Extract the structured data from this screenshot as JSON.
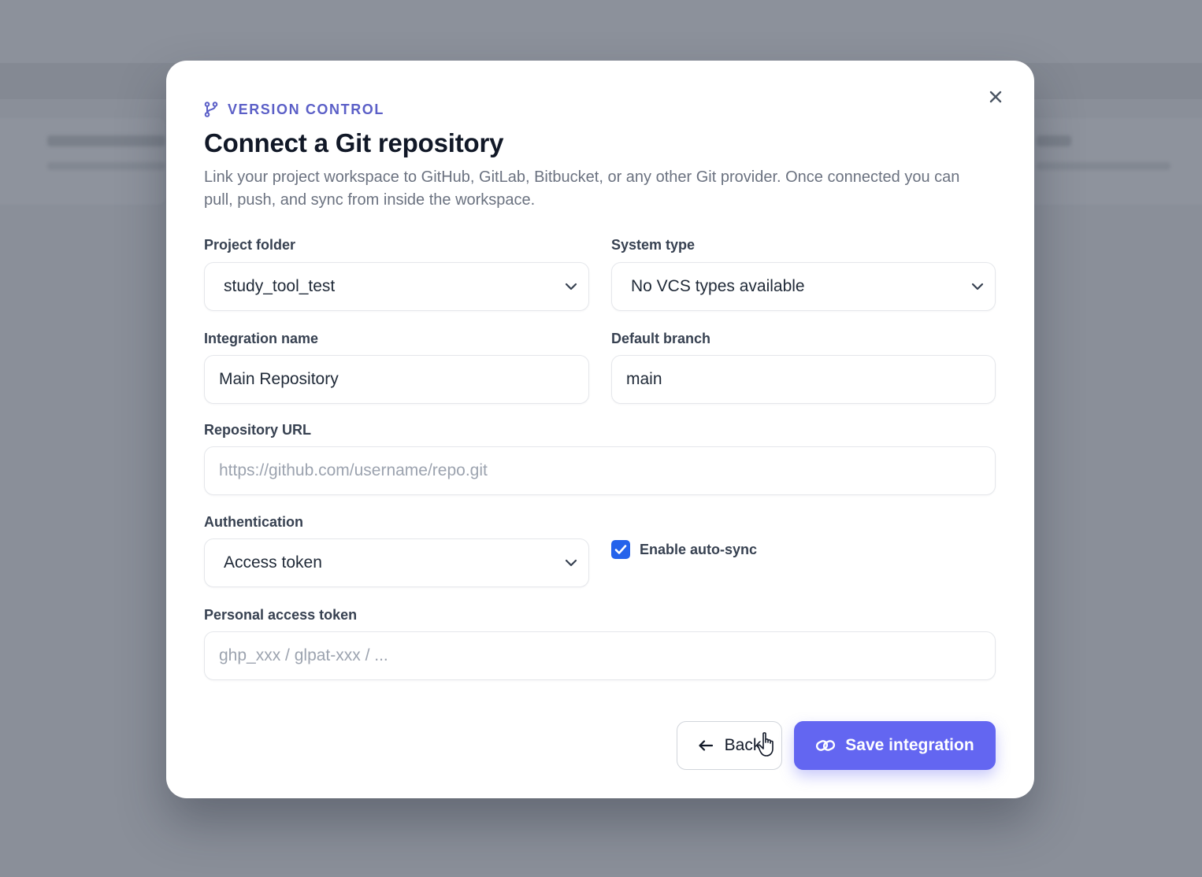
{
  "modal": {
    "eyebrow": "VERSION CONTROL",
    "title": "Connect a Git repository",
    "description": "Link your project workspace to GitHub, GitLab, Bitbucket, or any other Git provider. Once connected you can pull, push, and sync from inside the workspace."
  },
  "fields": {
    "project_folder": {
      "label": "Project folder",
      "value": "study_tool_test"
    },
    "system_type": {
      "label": "System type",
      "value": "No VCS types available"
    },
    "integration_name": {
      "label": "Integration name",
      "value": "Main Repository"
    },
    "default_branch": {
      "label": "Default branch",
      "value": "main"
    },
    "repository_url": {
      "label": "Repository URL",
      "value": "",
      "placeholder": "https://github.com/username/repo.git"
    },
    "authentication": {
      "label": "Authentication",
      "value": "Access token"
    },
    "auto_sync": {
      "label": "Enable auto-sync",
      "checked": true
    },
    "personal_access_token": {
      "label": "Personal access token",
      "value": "",
      "placeholder": "ghp_xxx / glpat-xxx / ..."
    }
  },
  "actions": {
    "back_label": "Back",
    "save_label": "Save integration"
  },
  "colors": {
    "accent": "#6366f1",
    "eyebrow": "#5b5fc7",
    "checkbox": "#2563eb",
    "overlay": "#8a8f99"
  },
  "icons": {
    "eyebrow": "git-branch-icon",
    "close": "close-icon",
    "select": "chevron-down-icon",
    "back": "arrow-left-icon",
    "save": "link-icon",
    "checkbox": "check-icon"
  }
}
